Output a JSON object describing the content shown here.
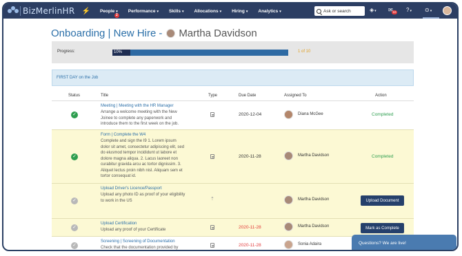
{
  "app": {
    "logo_text": "BizMerlinHR"
  },
  "nav": {
    "items": [
      {
        "label": "People",
        "badge": "2"
      },
      {
        "label": "Performance"
      },
      {
        "label": "Skills"
      },
      {
        "label": "Allocations"
      },
      {
        "label": "Hiring"
      },
      {
        "label": "Analytics"
      }
    ],
    "search_placeholder": "Ask or search",
    "mail_badge": "10"
  },
  "header": {
    "title": "Onboarding | New Hire",
    "separator": "-",
    "employee": "Martha Davidson"
  },
  "progress": {
    "label": "Progress:",
    "percent_text": "10%",
    "fraction": 0.1,
    "count_text": "1 of 10"
  },
  "section": {
    "title": "FIRST DAY on the Job"
  },
  "table": {
    "headers": {
      "status": "Status",
      "title": "Title",
      "type": "Type",
      "due": "Due Date",
      "assigned": "Assigned To",
      "action": "Action"
    },
    "rows": [
      {
        "title": "Meeting | Meeting with the HR Manager",
        "desc": "Arrange a welcome meeting with the New Joinee to complete any paperwork and introduce them to the first week on the job.",
        "due": "2020-12-04",
        "assignee": "Diana McGee",
        "action": "Completed"
      },
      {
        "title": "Form | Complete the W4",
        "desc": "Complete and sign the I9 1. Lorem ipsum dolor sit amet, consectetur adipiscing elit, sed do eiusmod tempor incididunt ut labore et dolore magna aliqua. 2. Lacus laoreet non curabitur gravida arcu ac tortor dignissim. 3. Aliquet lectus proin nibh nisl. Aliquam sem et tortor consequat id.",
        "due": "2020-11-28",
        "assignee": "Martha Davidson",
        "action": "Completed"
      },
      {
        "title": "Upload Driver's Licence/Passport",
        "desc": "Upload any photo ID as proof of your eligibility to work in the US",
        "due": "",
        "assignee": "Martha Davidson",
        "action": "Upload Document"
      },
      {
        "title": "Upload Certification",
        "desc": "Upload any proof of your Certificate",
        "due": "2020-11-28",
        "assignee": "Martha Davidson",
        "action": "Mark as Complete"
      },
      {
        "title": "Screening | Screening of Documentation",
        "desc": "Check that the documentation provided by",
        "due": "2020-11-28",
        "assignee": "Sonia Adaira",
        "action": ""
      }
    ]
  },
  "chat": {
    "label": "Questions? We are live!"
  },
  "colors": {
    "nav_bg": "#2c3e63",
    "accent": "#2b6fa8",
    "completed": "#2e9e4f",
    "overdue": "#e23a3a",
    "row_highlight": "#fcf9d4"
  }
}
